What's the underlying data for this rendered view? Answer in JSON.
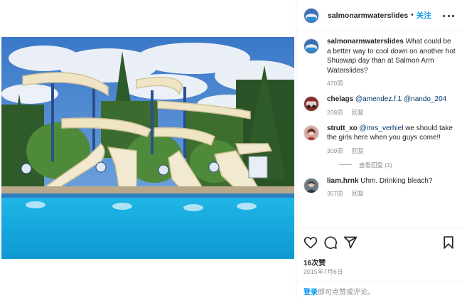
{
  "header": {
    "username": "salmonarmwaterslides",
    "separator": "•",
    "follow_label": "关注"
  },
  "caption": {
    "username": "salmonarmwaterslides",
    "text": "What could be a better way to cool down on another hot Shuswap day than at Salmon Arm Waterslides?",
    "time": "470周"
  },
  "comments": [
    {
      "username": "chelags",
      "mention1": "@amendez.f.1",
      "mention2": "@nando_204",
      "text": "",
      "time": "208周",
      "reply_label": "回复"
    },
    {
      "username": "strutt_xo",
      "mention1": "@mrs_verhiel",
      "mention2": "",
      "text": "we should take the girls here when you guys come!!",
      "time": "309周",
      "reply_label": "回复"
    },
    {
      "username": "liam.hrnk",
      "mention1": "",
      "mention2": "",
      "text": "Uhm. Drinking bleach?",
      "time": "357周",
      "reply_label": "回复"
    }
  ],
  "view_replies": "查看回复 (1)",
  "likes": "16次赞",
  "post_date": "2015年7月6日",
  "login_prompt": {
    "link": "登录",
    "text": "即可点赞或评论。"
  },
  "icons": [
    "heart-icon",
    "comment-icon",
    "share-icon",
    "bookmark-icon",
    "more-icon"
  ],
  "colors": {
    "accent": "#0095f6",
    "mention": "#00376b",
    "muted": "#8e8e8e"
  }
}
